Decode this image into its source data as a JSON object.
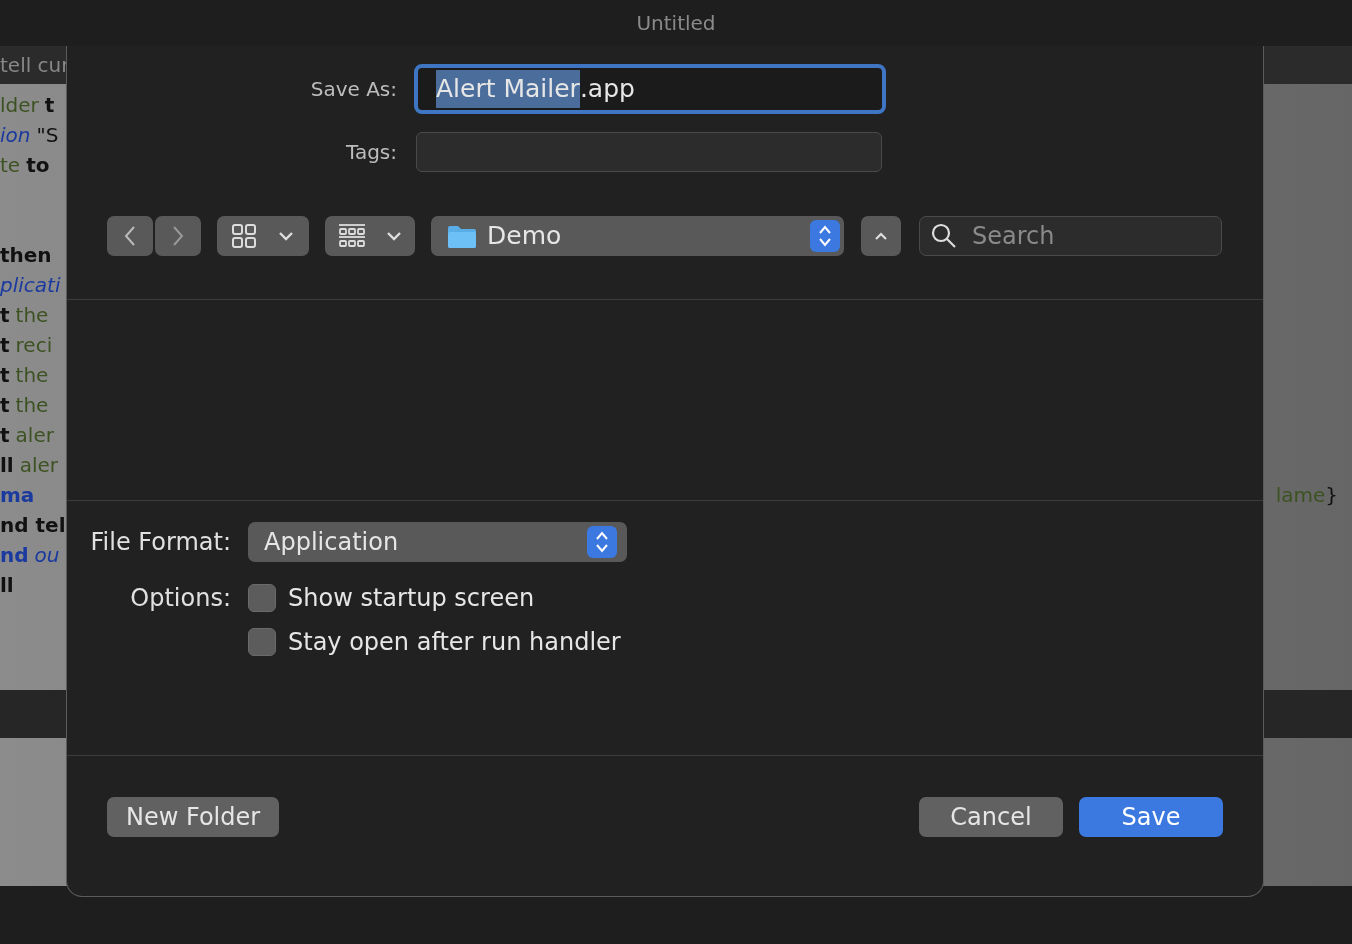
{
  "window": {
    "title": "Untitled"
  },
  "editor": {
    "toolbar_text": "tell cur",
    "lines": [
      {
        "left": [
          {
            "text": "lder",
            "kind": "variable"
          },
          {
            "text": "t",
            "kind": "keyword"
          }
        ]
      },
      {
        "left": [
          {
            "text": "ion",
            "kind": "class"
          },
          {
            "text": "\"S",
            "kind": "plain"
          }
        ]
      },
      {
        "left": [
          {
            "text": "te",
            "kind": "variable"
          },
          {
            "text": "to",
            "kind": "keyword"
          }
        ]
      },
      {
        "left": [
          {
            "text": "then",
            "kind": "keyword"
          }
        ],
        "after_blank": true
      },
      {
        "left": [
          {
            "text": "plicati",
            "kind": "class"
          }
        ]
      },
      {
        "left": [
          {
            "text": "t",
            "kind": "keyword"
          },
          {
            "text": "the",
            "kind": "variable"
          }
        ]
      },
      {
        "left": [
          {
            "text": "t",
            "kind": "keyword"
          },
          {
            "text": "reci",
            "kind": "variable"
          }
        ]
      },
      {
        "left": [
          {
            "text": "t",
            "kind": "keyword"
          },
          {
            "text": "the",
            "kind": "variable"
          }
        ]
      },
      {
        "left": [
          {
            "text": "t",
            "kind": "keyword"
          },
          {
            "text": "the",
            "kind": "variable"
          }
        ]
      },
      {
        "left": [
          {
            "text": "t",
            "kind": "keyword"
          },
          {
            "text": "aler",
            "kind": "variable"
          }
        ]
      },
      {
        "left": [
          {
            "text": "ll",
            "kind": "keyword"
          },
          {
            "text": "aler",
            "kind": "variable"
          }
        ]
      },
      {
        "left": [
          {
            "text": "ma",
            "kind": "command"
          }
        ],
        "right": [
          {
            "text": "lame",
            "kind": "variable"
          },
          {
            "text": "}",
            "kind": "plain"
          }
        ]
      },
      {
        "left": [
          {
            "text": "nd tel",
            "kind": "keyword"
          }
        ]
      },
      {
        "left": [
          {
            "text": "nd",
            "kind": "command"
          },
          {
            "text": "ou",
            "kind": "class"
          }
        ]
      },
      {
        "left": [
          {
            "text": "ll",
            "kind": "keyword"
          }
        ]
      }
    ]
  },
  "dialog": {
    "save_as": {
      "label": "Save As:",
      "value_parts": [
        {
          "text": "Alert Mailer",
          "selected": true
        },
        {
          "text": ".app",
          "selected": false
        }
      ]
    },
    "tags": {
      "label": "Tags:"
    },
    "location": {
      "folder": "Demo"
    },
    "search": {
      "placeholder": "Search"
    },
    "file_format": {
      "label": "File Format:",
      "value": "Application"
    },
    "options": {
      "label": "Options:",
      "items": [
        {
          "label": "Show startup screen",
          "checked": false
        },
        {
          "label": "Stay open after run handler",
          "checked": false
        }
      ]
    },
    "buttons": [
      {
        "label": "New Folder",
        "kind": "secondary"
      },
      {
        "label": "Cancel",
        "kind": "secondary"
      },
      {
        "label": "Save",
        "kind": "default"
      }
    ]
  }
}
